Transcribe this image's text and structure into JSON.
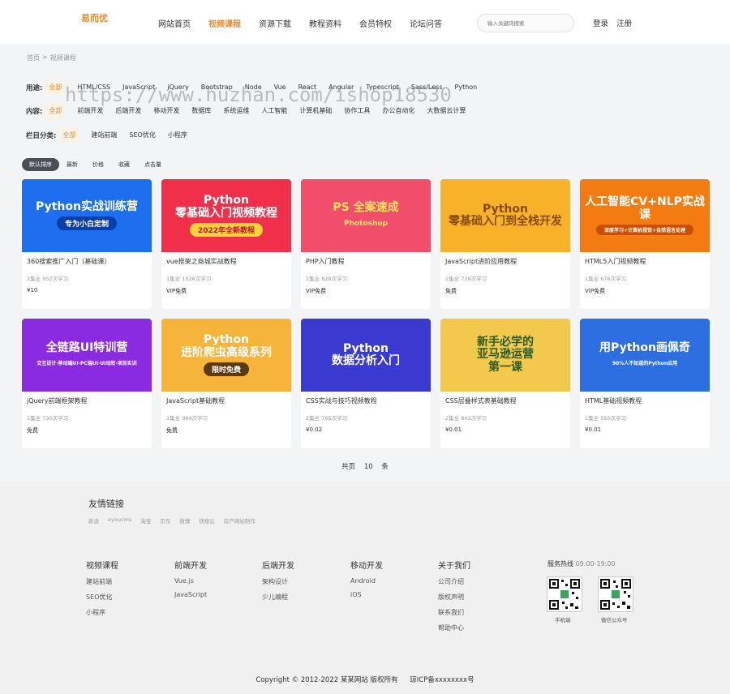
{
  "header": {
    "logo": "易而优",
    "nav": [
      "网站首页",
      "视频课程",
      "资源下载",
      "教程资料",
      "会员特权",
      "论坛问答"
    ],
    "active_nav": 1,
    "search_placeholder": "输入关键词搜索",
    "login": "登录",
    "register": "注册"
  },
  "breadcrumb": [
    "首页",
    ">",
    "视频课程"
  ],
  "filters": {
    "use": {
      "label": "用途:",
      "options": [
        "全部",
        "HTML/CSS",
        "JavaScript",
        "jQuery",
        "Bootstrap",
        "Node",
        "Vue",
        "React",
        "Angular",
        "Typescript",
        "Sass/Less",
        "Python"
      ]
    },
    "content": {
      "label": "内容:",
      "options": [
        "全部",
        "前端开发",
        "后端开发",
        "移动开发",
        "数据库",
        "系统运维",
        "人工智能",
        "计算机基础",
        "协作工具",
        "办公自动化",
        "大数据云计算"
      ]
    },
    "category": {
      "label": "栏目分类:",
      "options": [
        "全部",
        "建站前端",
        "SEO优化",
        "小程序"
      ]
    }
  },
  "sort": [
    "默认排序",
    "最新",
    "价格",
    "收藏",
    "点击量"
  ],
  "courses": [
    {
      "img_title": "Python实战训练营",
      "img_sub": "专为小白定制",
      "title": "360搜索推广入门（基础课）",
      "meta": "2集全 952次学习",
      "price": "¥10",
      "bg": "#1d6ff0",
      "fg": "#ffffff",
      "sub_bg": "#0a3fa8"
    },
    {
      "img_title": "Python\n零基础入门视频教程",
      "img_sub": "2022年全新教程",
      "title": "vue框架之商城实战教程",
      "meta": "1集全 1028次学习",
      "price": "VIP免费",
      "bg": "#f0304a",
      "fg": "#ffffff",
      "sub_bg": "#ffd23a"
    },
    {
      "img_title": "PS 全案速成",
      "img_sub": "Photoshop",
      "title": "PHP入门教程",
      "meta": "2集全 828次学习",
      "price": "VIP免费",
      "bg": "#f04e6a",
      "fg": "#ffe55a",
      "sub_bg": "transparent"
    },
    {
      "img_title": "Python\n零基础入门到全栈开发",
      "img_sub": "",
      "title": "JavaScript进阶应用教程",
      "meta": "2集全 719次学习",
      "price": "免费",
      "bg": "#f7b229",
      "fg": "#8a4b00",
      "sub_bg": "transparent"
    },
    {
      "img_title": "人工智能CV+NLP实战课",
      "img_sub": "深度学习+计算机视觉+自然语言处理",
      "title": "HTML5入门视频教程",
      "meta": "1集全 676次学习",
      "price": "VIP免费",
      "bg": "#f47a12",
      "fg": "#ffffff",
      "sub_bg": "#c84e00"
    },
    {
      "img_title": "全链路UI特训营",
      "img_sub": "交互设计·移动端UI·PC端UI·UI动效·项目实训",
      "title": "jQuery前端框架教程",
      "meta": "1集全 730次学习",
      "price": "免费",
      "bg": "#8a2be2",
      "fg": "#ffffff",
      "sub_bg": "transparent"
    },
    {
      "img_title": "Python\n进阶爬虫高级系列",
      "img_sub": "限时免费",
      "title": "JavaScript基础教程",
      "meta": "1集全 984次学习",
      "price": "免费",
      "bg": "#f6b43a",
      "fg": "#ffffff",
      "sub_bg": "#5a3a10"
    },
    {
      "img_title": "Python\n数据分析入门",
      "img_sub": "",
      "title": "CSS实战与技巧视频教程",
      "meta": "2集全 765次学习",
      "price": "¥0.02",
      "bg": "#3a3ad0",
      "fg": "#ffffff",
      "sub_bg": "transparent"
    },
    {
      "img_title": "新手必学的\n亚马逊运营\n第一课",
      "img_sub": "",
      "title": "CSS层叠样式表基础教程",
      "meta": "2集全 842次学习",
      "price": "¥0.01",
      "bg": "#f2c94c",
      "fg": "#2d5a1e",
      "sub_bg": "transparent"
    },
    {
      "img_title": "用Python画佩奇",
      "img_sub": "90%人不知道的Python应用",
      "title": "HTML基础视频教程",
      "meta": "1集全 550次学习",
      "price": "¥0.01",
      "bg": "#2d6fe0",
      "fg": "#ffffff",
      "sub_bg": "transparent"
    }
  ],
  "pager": [
    "共页",
    "10",
    "条"
  ],
  "footer": {
    "links_title": "友情链接",
    "links": [
      "新浪",
      "eyoucms",
      "淘宝",
      "京东",
      "微博",
      "快搜云",
      "房产网站制作"
    ],
    "columns": [
      {
        "title": "视频课程",
        "items": [
          "建站前端",
          "SEO优化",
          "小程序"
        ]
      },
      {
        "title": "前端开发",
        "items": [
          "Vue.js",
          "JavaScript"
        ]
      },
      {
        "title": "后端开发",
        "items": [
          "架构设计",
          "少儿编程"
        ]
      },
      {
        "title": "移动开发",
        "items": [
          "Android",
          "iOS"
        ]
      },
      {
        "title": "关于我们",
        "items": [
          "公司介绍",
          "版权声明",
          "联系我们",
          "帮助中心"
        ]
      }
    ],
    "hotline_label": "服务热线",
    "hotline_time": "09:00-19:00",
    "qr1": "手机端",
    "qr2": "微信公众号",
    "copyright": "Copyright © 2012-2022 某某网站 版权所有",
    "icp": "琼ICP备xxxxxxxx号"
  },
  "watermark": "https://www.huzhan.com/ishop18530"
}
